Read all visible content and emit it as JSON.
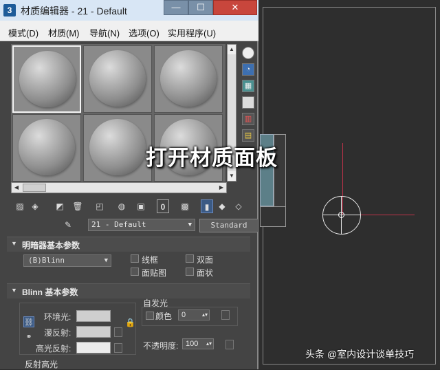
{
  "window": {
    "app_icon": "3",
    "title": "材质编辑器 - 21 - Default",
    "minimize": "—",
    "maximize": "☐",
    "close": "✕"
  },
  "menu": [
    "模式(D)",
    "材质(M)",
    "导航(N)",
    "选项(O)",
    "实用程序(U)"
  ],
  "material": {
    "name": "21 - Default",
    "type": "Standard"
  },
  "shader_rollout": {
    "title": "明暗器基本参数",
    "shader": "(B)Blinn",
    "options": [
      "线框",
      "双面",
      "面贴图",
      "面状"
    ]
  },
  "blinn_rollout": {
    "title": "Blinn 基本参数",
    "self_illum_title": "自发光",
    "color_label": "颜色",
    "color_value": "0",
    "opacity_label": "不透明度:",
    "opacity_value": "100",
    "ambient_label": "环境光:",
    "diffuse_label": "漫反射:",
    "specular_label": "高光反射:",
    "spec_highlights_label": "反射高光"
  },
  "overlay": {
    "caption": "打开材质面板",
    "watermark": "头条 @室内设计谈单技巧"
  },
  "icons": {
    "side_tools": [
      "sphere-type-icon",
      "backlight-icon",
      "background-checker-icon",
      "uv-tiling-icon",
      "video-color-check-icon",
      "make-preview-icon"
    ],
    "toolbar": [
      "get-material-icon",
      "put-to-scene-icon",
      "assign-to-selection-icon",
      "reset-map-icon",
      "make-unique-icon",
      "put-to-library-icon",
      "material-id-icon",
      "show-map-icon",
      "show-end-result-icon",
      "go-to-parent-icon",
      "go-forward-icon"
    ]
  }
}
